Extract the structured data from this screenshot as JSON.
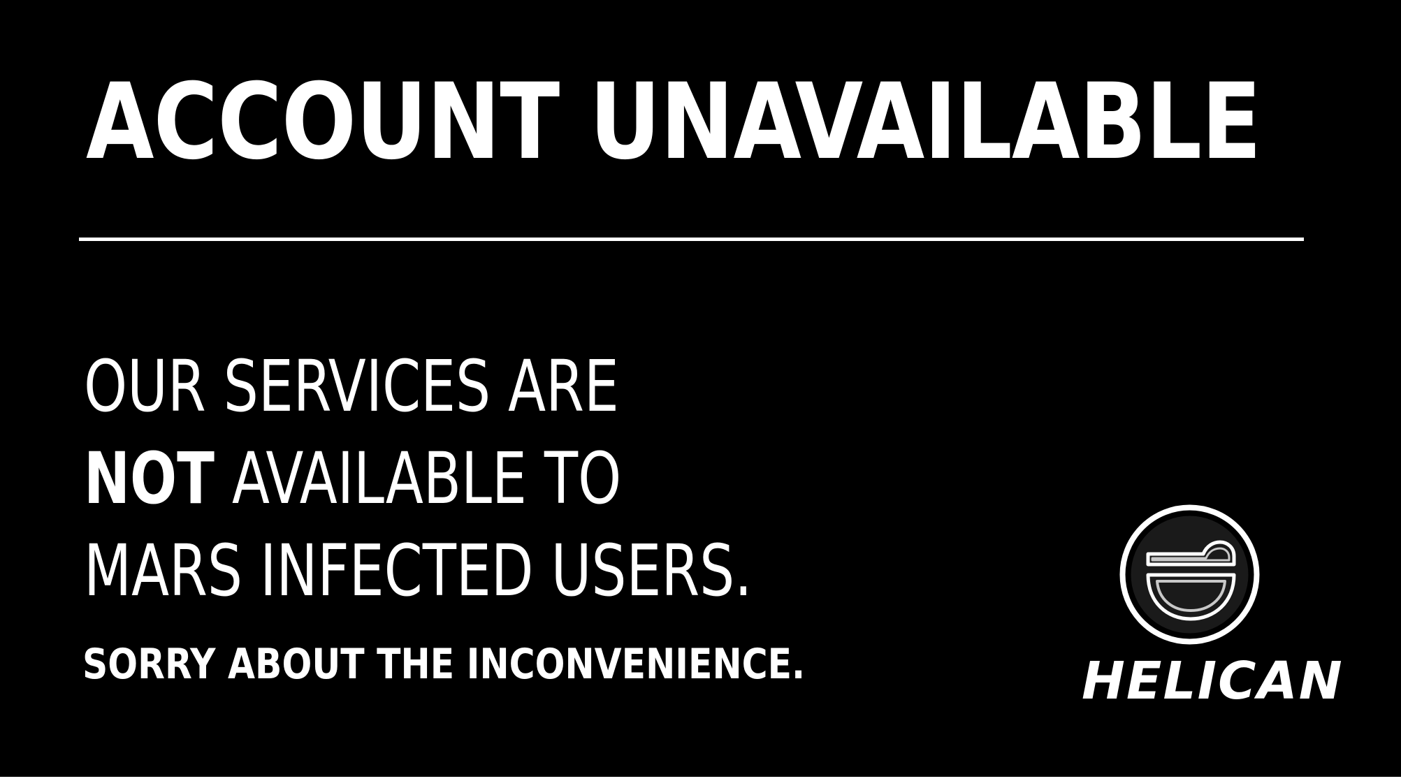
{
  "colors": {
    "background": "#000000",
    "text": "#ffffff",
    "logo_fill": "#1a1a1a",
    "logo_inner_stroke": "#c8c8c8"
  },
  "notice": {
    "title": "ACCOUNT UNAVAILABLE",
    "message": {
      "line1": "OUR SERVICES ARE",
      "line2_emphasis": "NOT",
      "line2_rest": " AVAILABLE TO",
      "line3": "MARS INFECTED USERS."
    },
    "apology": "SORRY ABOUT THE INCONVENIENCE."
  },
  "brand": {
    "name": "HELICAN",
    "logo_icon": "helican-logo-icon"
  }
}
